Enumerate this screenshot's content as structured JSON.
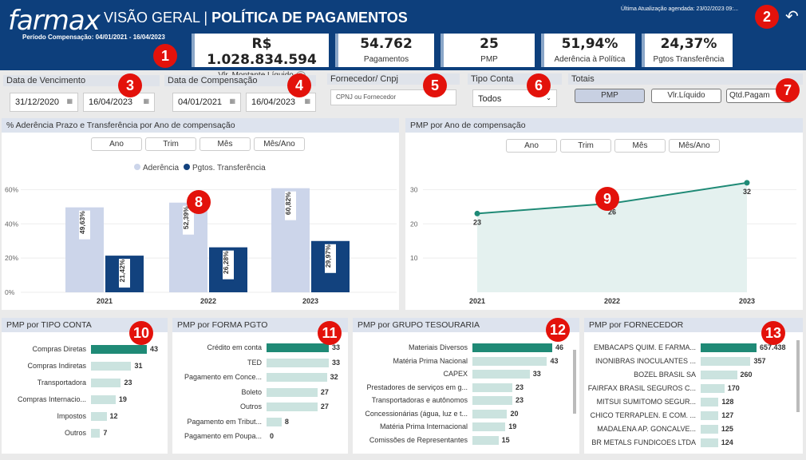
{
  "header": {
    "logo": "farmax",
    "title_light": "VISÃO GERAL",
    "title_bold": "POLÍTICA DE PAGAMENTOS",
    "period": "Período Compensação: 04/01/2021 - 16/04/2023",
    "updated": "Última Atualização agendada: 23/02/2023 09:...",
    "back_icon": "back-arrow-icon"
  },
  "kpis": [
    {
      "value": "R$ 1.028.834.594",
      "label": "Vlr. Montante Líquido"
    },
    {
      "value": "54.762",
      "label": "Pagamentos"
    },
    {
      "value": "25",
      "label": "PMP"
    },
    {
      "value": "51,94%",
      "label": "Aderência à Política"
    },
    {
      "value": "24,37%",
      "label": "Pgtos Transferência"
    }
  ],
  "filters": {
    "venc_label": "Data de Vencimento",
    "venc_from": "31/12/2020",
    "venc_to": "16/04/2023",
    "comp_label": "Data de Compensação",
    "comp_from": "04/01/2021",
    "comp_to": "16/04/2023",
    "forn_label": "Fornecedor/ Cnpj",
    "forn_placeholder": "CPNJ ou Fornecedor",
    "tipo_label": "Tipo Conta",
    "tipo_value": "Todos",
    "totais_label": "Totais",
    "totais": [
      "PMP",
      "Vlr.Líquido",
      "Qtd.Pagam"
    ]
  },
  "badges": [
    "1",
    "2",
    "3",
    "4",
    "5",
    "6",
    "7",
    "8",
    "9",
    "10",
    "11",
    "12",
    "13"
  ],
  "chart_left": {
    "title": "% Aderência Prazo e Transferência por Ano de compensação",
    "buttons": [
      "Ano",
      "Trim",
      "Mês",
      "Mês/Ano"
    ]
  },
  "chart_right": {
    "title": "PMP por Ano de compensação",
    "buttons": [
      "Ano",
      "Trim",
      "Mês",
      "Mês/Ano"
    ]
  },
  "chart_data": [
    {
      "type": "bar",
      "categories": [
        "2021",
        "2022",
        "2023"
      ],
      "series": [
        {
          "name": "Aderência",
          "values": [
            49.63,
            52.39,
            60.82
          ],
          "labels": [
            "49,63%",
            "52,39%",
            "60,82%"
          ],
          "color": "#ccd5ea"
        },
        {
          "name": "Pgtos. Transferência",
          "values": [
            21.42,
            26.28,
            29.97
          ],
          "labels": [
            "21,42%",
            "26,28%",
            "29,97%"
          ],
          "color": "#12427e"
        }
      ],
      "yticks": [
        "0%",
        "20%",
        "40%",
        "60%"
      ],
      "ylim": [
        0,
        70
      ]
    },
    {
      "type": "area",
      "x": [
        "2021",
        "2022",
        "2023"
      ],
      "values": [
        23,
        26,
        32
      ],
      "yticks": [
        "10",
        "20",
        "30"
      ],
      "ylim": [
        0,
        35
      ],
      "color": "#1f8a76"
    },
    {
      "type": "bar",
      "title": "PMP por TIPO CONTA",
      "categories": [
        "Compras Diretas",
        "Compras Indiretas",
        "Transportadora",
        "Compras Internacio...",
        "Impostos",
        "Outros"
      ],
      "values": [
        43,
        31,
        23,
        19,
        12,
        7
      ],
      "labels": [
        "43",
        "31",
        "23",
        "19",
        "12",
        "7"
      ]
    },
    {
      "type": "bar",
      "title": "PMP por FORMA PGTO",
      "categories": [
        "Crédito em conta",
        "TED",
        "Pagamento em Conce...",
        "Boleto",
        "Outros",
        "Pagamento em Tribut...",
        "Pagamento em Poupa..."
      ],
      "values": [
        33,
        33,
        32,
        27,
        27,
        8,
        0
      ],
      "labels": [
        "33",
        "33",
        "32",
        "27",
        "27",
        "8",
        "0"
      ]
    },
    {
      "type": "bar",
      "title": "PMP por GRUPO TESOURARIA",
      "categories": [
        "Materiais Diversos",
        "Matéria Prima Nacional",
        "CAPEX",
        "Prestadores de serviços em g...",
        "Transportadoras e autônomos",
        "Concessionárias (água, luz e t...",
        "Matéria Prima Internacional",
        "Comissões de Representantes"
      ],
      "values": [
        46,
        43,
        33,
        23,
        23,
        20,
        19,
        15
      ],
      "labels": [
        "46",
        "43",
        "33",
        "23",
        "23",
        "20",
        "19",
        "15"
      ]
    },
    {
      "type": "bar",
      "title": "PMP por FORNECEDOR",
      "categories": [
        "EMBACAPS QUIM. E FARMA...",
        "INONIBRAS INOCULANTES ...",
        "BOZEL BRASIL SA",
        "FAIRFAX BRASIL SEGUROS C...",
        "MITSUI SUMITOMO SEGUR...",
        "CHICO TERRAPLEN. E COM. ...",
        "MADALENA AP. GONCALVE...",
        "BR METALS FUNDICOES LTDA"
      ],
      "values": [
        657438,
        357,
        260,
        170,
        128,
        127,
        125,
        124
      ],
      "labels": [
        "657.438",
        "357",
        "260",
        "170",
        "128",
        "127",
        "125",
        "124"
      ]
    }
  ]
}
